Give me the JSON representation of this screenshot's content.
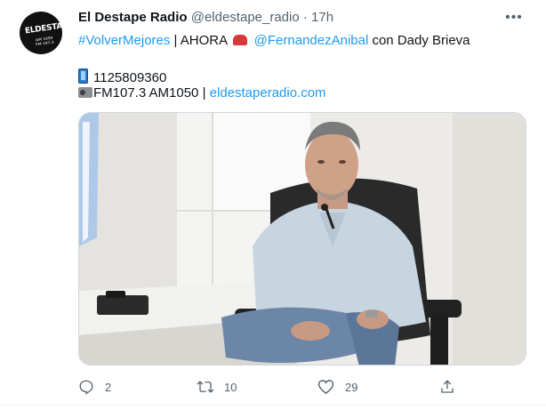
{
  "tweet": {
    "display_name": "El Destape Radio",
    "handle": "@eldestape_radio",
    "separator": "·",
    "time": "17h",
    "avatar_text": "ELDESTAPE",
    "avatar_subtext": "AM 1050 FM 107.3",
    "line1": {
      "hashtag": "#VolverMejores",
      "mid": " | AHORA ",
      "mention": "@FernandezAnibal",
      "tail": " con Dady Brieva"
    },
    "phone": "1125809360",
    "radio_text": "FM107.3 AM1050 | ",
    "website": "eldestaperadio.com",
    "more_icon": "more-horizontal-icon"
  },
  "actions": {
    "reply": {
      "icon": "reply-icon",
      "count": "2"
    },
    "retweet": {
      "icon": "retweet-icon",
      "count": "10"
    },
    "like": {
      "icon": "heart-icon",
      "count": "29"
    },
    "share": {
      "icon": "share-icon",
      "count": ""
    }
  },
  "colors": {
    "link": "#1d9bf0",
    "muted": "#536471",
    "text": "#0f1419"
  }
}
